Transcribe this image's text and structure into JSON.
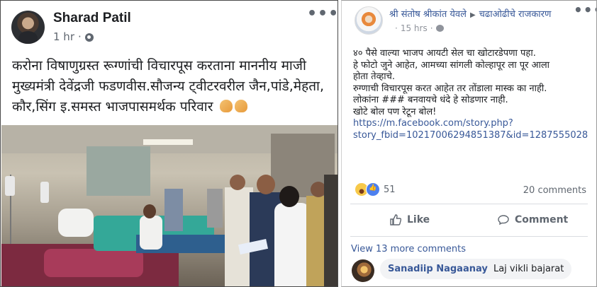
{
  "left_post": {
    "author": "Sharad Patil",
    "time": "1 hr",
    "more_icon": "more-options-icon",
    "text": "करोना विषाणुग्रस्त रूग्णांची विचारपूस करताना माननीय माजी मुख्यमंत्री देवेंद्रजी फडणवीस.सौजन्य ट्वीटरवरील जैन,पांडे,मेहता, कौर,सिंग इ.समस्त भाजपासमर्थक परिवार",
    "emoji": [
      "folded-hands-icon",
      "folded-hands-icon"
    ]
  },
  "right_post": {
    "author": "श्री संतोष श्रीकांत येवले",
    "group": "चढाओढीचे राजकारण",
    "time": "15 hrs",
    "text_lines": [
      "४० पैसे वाल्या भाजप आयटी सेल चा खोटारडेपणा पहा.",
      "हे फोटो जुने आहेत, आमच्या सांगली कोल्हापूर ला पूर आला",
      "होता तेव्हाचे.",
      "रुग्णाची विचारपूस करत आहेत तर तोंडाला मास्क का नाही.",
      "लोकांना ### बनवायचे धंदे हे सोडणार नाही.",
      "खोटे बोल पण रेटून बोल!"
    ],
    "link_lines": [
      "https://m.facebook.com/story.php?",
      "story_fbid=10217006294851387&id=1287555028"
    ],
    "reactions_count": "51",
    "comments_count": "20 comments",
    "like_label": "Like",
    "comment_label": "Comment",
    "view_more": "View 13 more comments",
    "comment": {
      "author": "Sanadiip Nagaanay",
      "text": "Laj vikli bajarat"
    }
  },
  "colors": {
    "link": "#385898",
    "text": "#1c1e21",
    "meta": "#606770",
    "bubble": "#f2f3f5"
  }
}
